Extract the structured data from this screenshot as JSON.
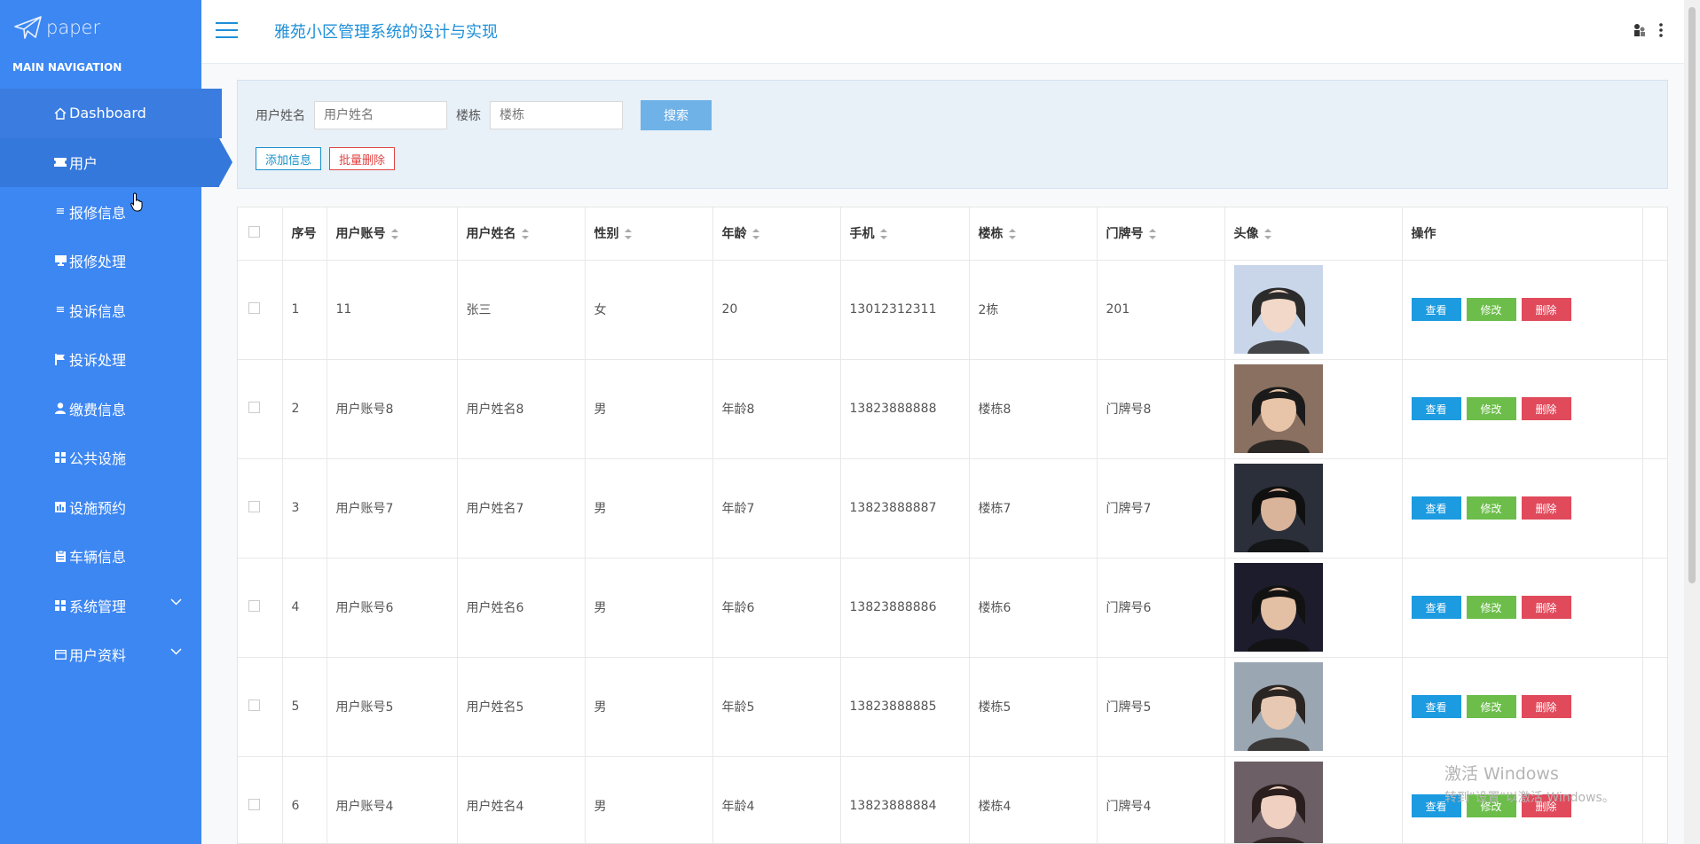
{
  "sidebar": {
    "logo_text": "paper",
    "nav_header": "MAIN NAVIGATION",
    "items": [
      {
        "label": "Dashboard",
        "icon": "home-icon"
      },
      {
        "label": "用户",
        "icon": "ticket-icon"
      },
      {
        "label": "报修信息",
        "icon": "list-icon"
      },
      {
        "label": "报修处理",
        "icon": "monitor-icon"
      },
      {
        "label": "投诉信息",
        "icon": "list-icon"
      },
      {
        "label": "投诉处理",
        "icon": "flag-icon"
      },
      {
        "label": "缴费信息",
        "icon": "user-icon"
      },
      {
        "label": "公共设施",
        "icon": "grid-icon"
      },
      {
        "label": "设施预约",
        "icon": "chart-icon"
      },
      {
        "label": "车辆信息",
        "icon": "clipboard-icon"
      },
      {
        "label": "系统管理",
        "icon": "grid-icon"
      },
      {
        "label": "用户资料",
        "icon": "card-icon"
      }
    ]
  },
  "header": {
    "title": "雅苑小区管理系统的设计与实现"
  },
  "search": {
    "name_label": "用户姓名",
    "name_placeholder": "用户姓名",
    "building_label": "楼栋",
    "building_placeholder": "楼栋",
    "search_button": "搜索",
    "add_button": "添加信息",
    "batch_delete_button": "批量删除"
  },
  "table": {
    "headers": [
      "序号",
      "用户账号",
      "用户姓名",
      "性别",
      "年龄",
      "手机",
      "楼栋",
      "门牌号",
      "头像",
      "操作"
    ],
    "rows": [
      [
        "1",
        "11",
        "张三",
        "女",
        "20",
        "13012312311",
        "2栋",
        "201"
      ],
      [
        "2",
        "用户账号8",
        "用户姓名8",
        "男",
        "年龄8",
        "13823888888",
        "楼栋8",
        "门牌号8"
      ],
      [
        "3",
        "用户账号7",
        "用户姓名7",
        "男",
        "年龄7",
        "13823888887",
        "楼栋7",
        "门牌号7"
      ],
      [
        "4",
        "用户账号6",
        "用户姓名6",
        "男",
        "年龄6",
        "13823888886",
        "楼栋6",
        "门牌号6"
      ],
      [
        "5",
        "用户账号5",
        "用户姓名5",
        "男",
        "年龄5",
        "13823888885",
        "楼栋5",
        "门牌号5"
      ],
      [
        "6",
        "用户账号4",
        "用户姓名4",
        "男",
        "年龄4",
        "13823888884",
        "楼栋4",
        "门牌号4"
      ]
    ],
    "actions": {
      "view": "查看",
      "edit": "修改",
      "delete": "删除"
    }
  },
  "watermark": {
    "line1": "激活 Windows",
    "line2": "转到\"设置\"以激活 Windows。"
  }
}
